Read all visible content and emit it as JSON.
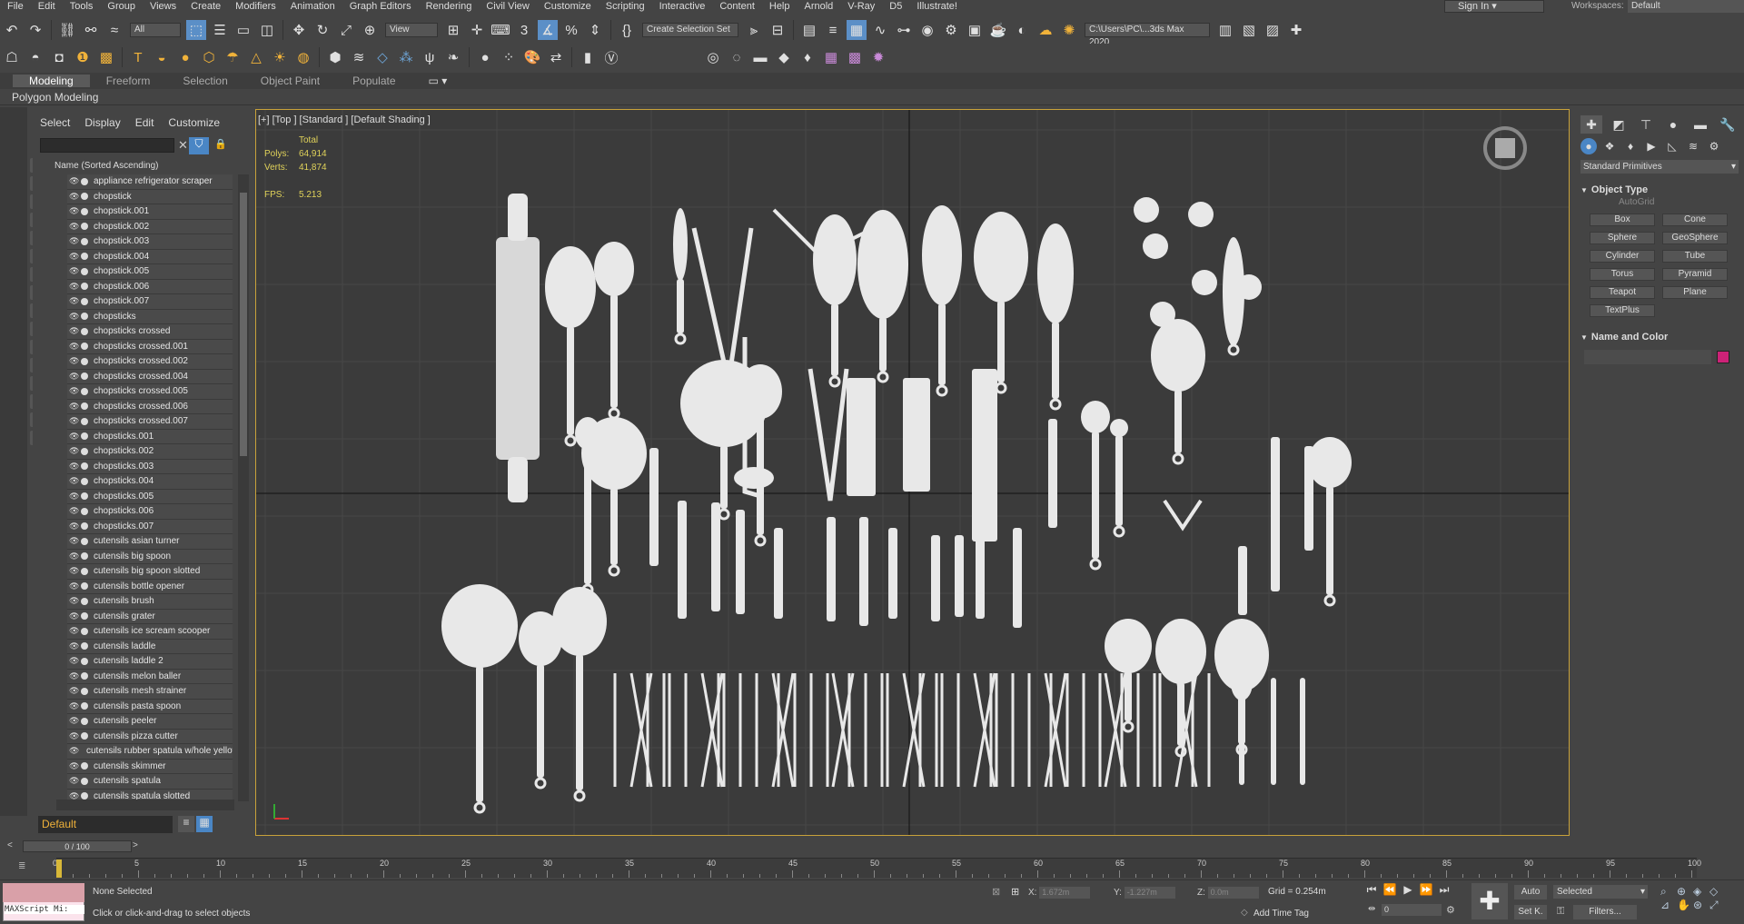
{
  "menu": [
    "File",
    "Edit",
    "Tools",
    "Group",
    "Views",
    "Create",
    "Modifiers",
    "Animation",
    "Graph Editors",
    "Rendering",
    "Civil View",
    "Customize",
    "Scripting",
    "Interactive",
    "Content",
    "Help",
    "Arnold",
    "V-Ray",
    "D5",
    "Illustrate!"
  ],
  "sign_in": "Sign In",
  "workspace_label": "Workspaces:",
  "workspace_value": "Default",
  "toolbar": {
    "filter_select": "All",
    "refcoord_select": "View",
    "selection_set": "Create Selection Set",
    "project_path": "C:\\Users\\PC\\...3ds Max 2020"
  },
  "ribbon": {
    "tabs": [
      "Modeling",
      "Freeform",
      "Selection",
      "Object Paint",
      "Populate"
    ],
    "active": "Modeling",
    "subtitle": "Polygon Modeling"
  },
  "explorer": {
    "menu": [
      "Select",
      "Display",
      "Edit",
      "Customize"
    ],
    "column_header": "Name (Sorted Ascending)",
    "items": [
      "appliance refrigerator scraper",
      "chopstick",
      "chopstick.001",
      "chopstick.002",
      "chopstick.003",
      "chopstick.004",
      "chopstick.005",
      "chopstick.006",
      "chopstick.007",
      "chopsticks",
      "chopsticks crossed",
      "chopsticks crossed.001",
      "chopsticks crossed.002",
      "chopsticks crossed.004",
      "chopsticks crossed.005",
      "chopsticks crossed.006",
      "chopsticks crossed.007",
      "chopsticks.001",
      "chopsticks.002",
      "chopsticks.003",
      "chopsticks.004",
      "chopsticks.005",
      "chopsticks.006",
      "chopsticks.007",
      "cutensils asian turner",
      "cutensils big spoon",
      "cutensils big spoon slotted",
      "cutensils bottle opener",
      "cutensils brush",
      "cutensils grater",
      "cutensils ice scream scooper",
      "cutensils laddle",
      "cutensils laddle 2",
      "cutensils melon baller",
      "cutensils mesh strainer",
      "cutensils pasta spoon",
      "cutensils peeler",
      "cutensils pizza cutter",
      "cutensils rubber spatula w/hole yellow",
      "cutensils skimmer",
      "cutensils spatula",
      "cutensils spatula slotted"
    ],
    "layer": "Default"
  },
  "viewport": {
    "label": "[+] [Top ] [Standard ] [Default Shading ]",
    "stats_header": "Total",
    "polys_label": "Polys:",
    "polys": "64,914",
    "verts_label": "Verts:",
    "verts": "41,874",
    "fps_label": "FPS:",
    "fps": "5.213",
    "viewcube": {
      "top": "TOP",
      "n": "N",
      "s": "S",
      "w": "W",
      "e": "E"
    }
  },
  "command_panel": {
    "category": "Standard Primitives",
    "object_type_title": "Object Type",
    "autogrid": "AutoGrid",
    "objects": [
      "Box",
      "Cone",
      "Sphere",
      "GeoSphere",
      "Cylinder",
      "Tube",
      "Torus",
      "Pyramid",
      "Teapot",
      "Plane",
      "TextPlus"
    ],
    "name_color_title": "Name and Color",
    "color": "#cc2277"
  },
  "timeline": {
    "slider": "0 / 100",
    "ticks": [
      "0",
      "5",
      "10",
      "15",
      "20",
      "25",
      "30",
      "35",
      "40",
      "45",
      "50",
      "55",
      "60",
      "65",
      "70",
      "75",
      "80",
      "85",
      "90",
      "95",
      "100"
    ]
  },
  "status": {
    "maxscript": "MAXScript Mi:",
    "selection": "None Selected",
    "prompt": "Click or click-and-drag to select objects",
    "x_label": "X:",
    "x": "1.672m",
    "y_label": "Y:",
    "y": "-1.227m",
    "z_label": "Z:",
    "z": "0.0m",
    "grid": "Grid = 0.254m",
    "add_time_tag": "Add Time Tag",
    "frame": "0",
    "auto": "Auto",
    "setk": "Set K.",
    "key_filter": "Selected",
    "filters": "Filters..."
  }
}
